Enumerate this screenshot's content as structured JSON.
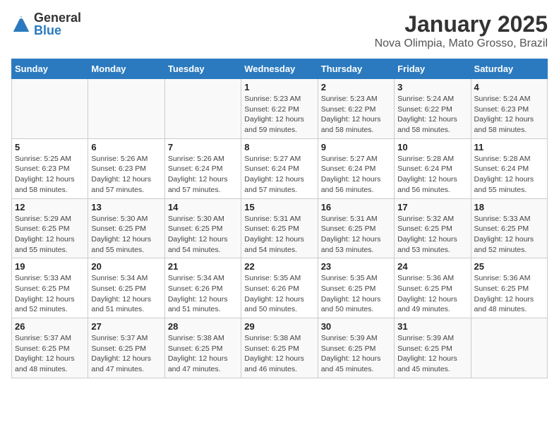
{
  "header": {
    "logo_general": "General",
    "logo_blue": "Blue",
    "title": "January 2025",
    "subtitle": "Nova Olimpia, Mato Grosso, Brazil"
  },
  "weekdays": [
    "Sunday",
    "Monday",
    "Tuesday",
    "Wednesday",
    "Thursday",
    "Friday",
    "Saturday"
  ],
  "weeks": [
    [
      {
        "day": "",
        "info": ""
      },
      {
        "day": "",
        "info": ""
      },
      {
        "day": "",
        "info": ""
      },
      {
        "day": "1",
        "info": "Sunrise: 5:23 AM\nSunset: 6:22 PM\nDaylight: 12 hours and 59 minutes."
      },
      {
        "day": "2",
        "info": "Sunrise: 5:23 AM\nSunset: 6:22 PM\nDaylight: 12 hours and 58 minutes."
      },
      {
        "day": "3",
        "info": "Sunrise: 5:24 AM\nSunset: 6:22 PM\nDaylight: 12 hours and 58 minutes."
      },
      {
        "day": "4",
        "info": "Sunrise: 5:24 AM\nSunset: 6:23 PM\nDaylight: 12 hours and 58 minutes."
      }
    ],
    [
      {
        "day": "5",
        "info": "Sunrise: 5:25 AM\nSunset: 6:23 PM\nDaylight: 12 hours and 58 minutes."
      },
      {
        "day": "6",
        "info": "Sunrise: 5:26 AM\nSunset: 6:23 PM\nDaylight: 12 hours and 57 minutes."
      },
      {
        "day": "7",
        "info": "Sunrise: 5:26 AM\nSunset: 6:24 PM\nDaylight: 12 hours and 57 minutes."
      },
      {
        "day": "8",
        "info": "Sunrise: 5:27 AM\nSunset: 6:24 PM\nDaylight: 12 hours and 57 minutes."
      },
      {
        "day": "9",
        "info": "Sunrise: 5:27 AM\nSunset: 6:24 PM\nDaylight: 12 hours and 56 minutes."
      },
      {
        "day": "10",
        "info": "Sunrise: 5:28 AM\nSunset: 6:24 PM\nDaylight: 12 hours and 56 minutes."
      },
      {
        "day": "11",
        "info": "Sunrise: 5:28 AM\nSunset: 6:24 PM\nDaylight: 12 hours and 55 minutes."
      }
    ],
    [
      {
        "day": "12",
        "info": "Sunrise: 5:29 AM\nSunset: 6:25 PM\nDaylight: 12 hours and 55 minutes."
      },
      {
        "day": "13",
        "info": "Sunrise: 5:30 AM\nSunset: 6:25 PM\nDaylight: 12 hours and 55 minutes."
      },
      {
        "day": "14",
        "info": "Sunrise: 5:30 AM\nSunset: 6:25 PM\nDaylight: 12 hours and 54 minutes."
      },
      {
        "day": "15",
        "info": "Sunrise: 5:31 AM\nSunset: 6:25 PM\nDaylight: 12 hours and 54 minutes."
      },
      {
        "day": "16",
        "info": "Sunrise: 5:31 AM\nSunset: 6:25 PM\nDaylight: 12 hours and 53 minutes."
      },
      {
        "day": "17",
        "info": "Sunrise: 5:32 AM\nSunset: 6:25 PM\nDaylight: 12 hours and 53 minutes."
      },
      {
        "day": "18",
        "info": "Sunrise: 5:33 AM\nSunset: 6:25 PM\nDaylight: 12 hours and 52 minutes."
      }
    ],
    [
      {
        "day": "19",
        "info": "Sunrise: 5:33 AM\nSunset: 6:25 PM\nDaylight: 12 hours and 52 minutes."
      },
      {
        "day": "20",
        "info": "Sunrise: 5:34 AM\nSunset: 6:25 PM\nDaylight: 12 hours and 51 minutes."
      },
      {
        "day": "21",
        "info": "Sunrise: 5:34 AM\nSunset: 6:26 PM\nDaylight: 12 hours and 51 minutes."
      },
      {
        "day": "22",
        "info": "Sunrise: 5:35 AM\nSunset: 6:26 PM\nDaylight: 12 hours and 50 minutes."
      },
      {
        "day": "23",
        "info": "Sunrise: 5:35 AM\nSunset: 6:25 PM\nDaylight: 12 hours and 50 minutes."
      },
      {
        "day": "24",
        "info": "Sunrise: 5:36 AM\nSunset: 6:25 PM\nDaylight: 12 hours and 49 minutes."
      },
      {
        "day": "25",
        "info": "Sunrise: 5:36 AM\nSunset: 6:25 PM\nDaylight: 12 hours and 48 minutes."
      }
    ],
    [
      {
        "day": "26",
        "info": "Sunrise: 5:37 AM\nSunset: 6:25 PM\nDaylight: 12 hours and 48 minutes."
      },
      {
        "day": "27",
        "info": "Sunrise: 5:37 AM\nSunset: 6:25 PM\nDaylight: 12 hours and 47 minutes."
      },
      {
        "day": "28",
        "info": "Sunrise: 5:38 AM\nSunset: 6:25 PM\nDaylight: 12 hours and 47 minutes."
      },
      {
        "day": "29",
        "info": "Sunrise: 5:38 AM\nSunset: 6:25 PM\nDaylight: 12 hours and 46 minutes."
      },
      {
        "day": "30",
        "info": "Sunrise: 5:39 AM\nSunset: 6:25 PM\nDaylight: 12 hours and 45 minutes."
      },
      {
        "day": "31",
        "info": "Sunrise: 5:39 AM\nSunset: 6:25 PM\nDaylight: 12 hours and 45 minutes."
      },
      {
        "day": "",
        "info": ""
      }
    ]
  ]
}
